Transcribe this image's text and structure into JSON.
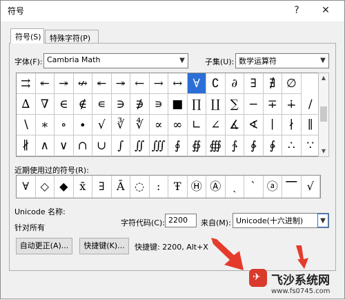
{
  "window": {
    "title": "符号",
    "help": "?",
    "close": "✕"
  },
  "tabs": [
    {
      "label": "符号(S)"
    },
    {
      "label": "特殊字符(P)"
    }
  ],
  "font": {
    "label": "字体(F):",
    "value": "Cambria Math"
  },
  "subset": {
    "label": "子集(U):",
    "value": "数学运算符"
  },
  "symbols": [
    [
      "⇉",
      "↞",
      "↠",
      "↮",
      "↞",
      "↠",
      "←",
      "→",
      "↔",
      "∀",
      "∁",
      "∂",
      "∃",
      "∄",
      "∅"
    ],
    [
      "∆",
      "∇",
      "∈",
      "∉",
      "∊",
      "∋",
      "∌",
      "∍",
      "■",
      "∏",
      "∐",
      "∑",
      "−",
      "∓",
      "∔",
      "∕"
    ],
    [
      "∖",
      "∗",
      "∘",
      "∙",
      "√",
      "∛",
      "∜",
      "∝",
      "∞",
      "∟",
      "∠",
      "∡",
      "∢",
      "∣",
      "∤",
      "∥"
    ],
    [
      "∦",
      "∧",
      "∨",
      "∩",
      "∪",
      "∫",
      "∬",
      "∭",
      "∮",
      "∯",
      "∰",
      "∱",
      "∲",
      "∳",
      "∴",
      "∵"
    ]
  ],
  "selected": {
    "row": 0,
    "col": 9
  },
  "recent": {
    "label": "近期使用过的符号(R):",
    "items": [
      "∀",
      "◇",
      "◆",
      "x̄",
      "∃",
      "Ā",
      "◌",
      ":",
      "Ŧ",
      "Ⓗ",
      "Ⓐ",
      "ˎ",
      "ˋ",
      "ⓐ",
      "⎺",
      "√"
    ]
  },
  "unicode_name": {
    "label": "Unicode 名称:",
    "value": "针对所有"
  },
  "char_code": {
    "label": "字符代码(C):",
    "value": "2200"
  },
  "from": {
    "label": "来自(M):",
    "value": "Unicode(十六进制)"
  },
  "buttons": {
    "autocorrect": "自动更正(A)...",
    "shortcut_key": "快捷键(K)..."
  },
  "shortcut_text": "快捷键: 2200, Alt+X",
  "watermark": {
    "title": "飞沙系统网",
    "url": "www.fs0745.com"
  },
  "colors": {
    "selection": "#2b6fd6",
    "arrow": "#e53b2c"
  }
}
